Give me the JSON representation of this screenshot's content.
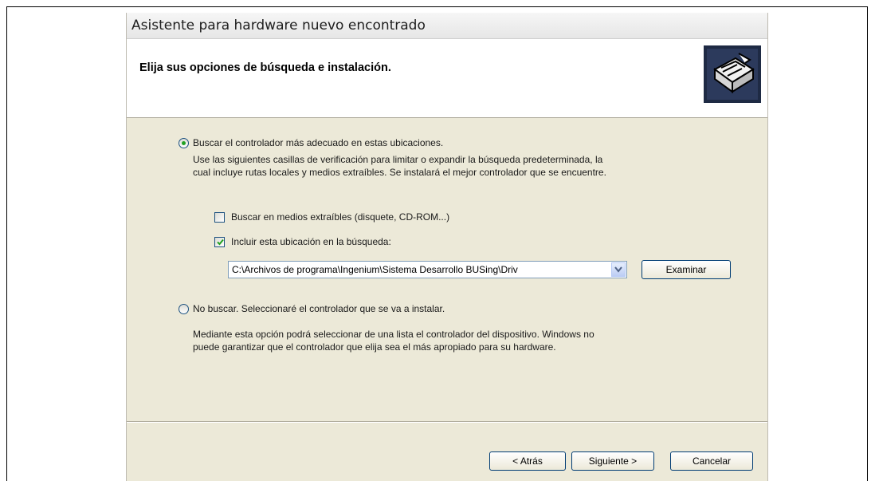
{
  "window": {
    "title": "Asistente para hardware nuevo encontrado"
  },
  "header": {
    "heading": "Elija sus opciones de búsqueda e instalación.",
    "icon": "hardware-wizard-icon"
  },
  "option_search": {
    "label": "Buscar el controlador más adecuado en estas ubicaciones.",
    "selected": true,
    "description_line1": "Use las siguientes casillas de verificación para limitar o expandir la búsqueda predeterminada, la",
    "description_line2": "cual incluye rutas locales y medios extraíbles. Se instalará el mejor controlador que se encuentre.",
    "checkbox_removable": {
      "label": "Buscar en medios extraíbles (disquete, CD-ROM...)",
      "checked": false
    },
    "checkbox_include_location": {
      "label": "Incluir esta ubicación en la búsqueda:",
      "checked": true
    },
    "path_value": "C:\\Archivos de programa\\Ingenium\\Sistema Desarrollo BUSing\\Driv",
    "browse_label": "Examinar"
  },
  "option_manual": {
    "label": "No buscar. Seleccionaré el controlador que se va a instalar.",
    "selected": false,
    "description_line1": "Mediante esta opción podrá seleccionar de una lista el controlador del dispositivo. Windows no",
    "description_line2": "puede garantizar que el controlador que elija sea el más apropiado para su hardware."
  },
  "footer": {
    "back_label": "< Atrás",
    "next_label": "Siguiente >",
    "cancel_label": "Cancelar"
  }
}
